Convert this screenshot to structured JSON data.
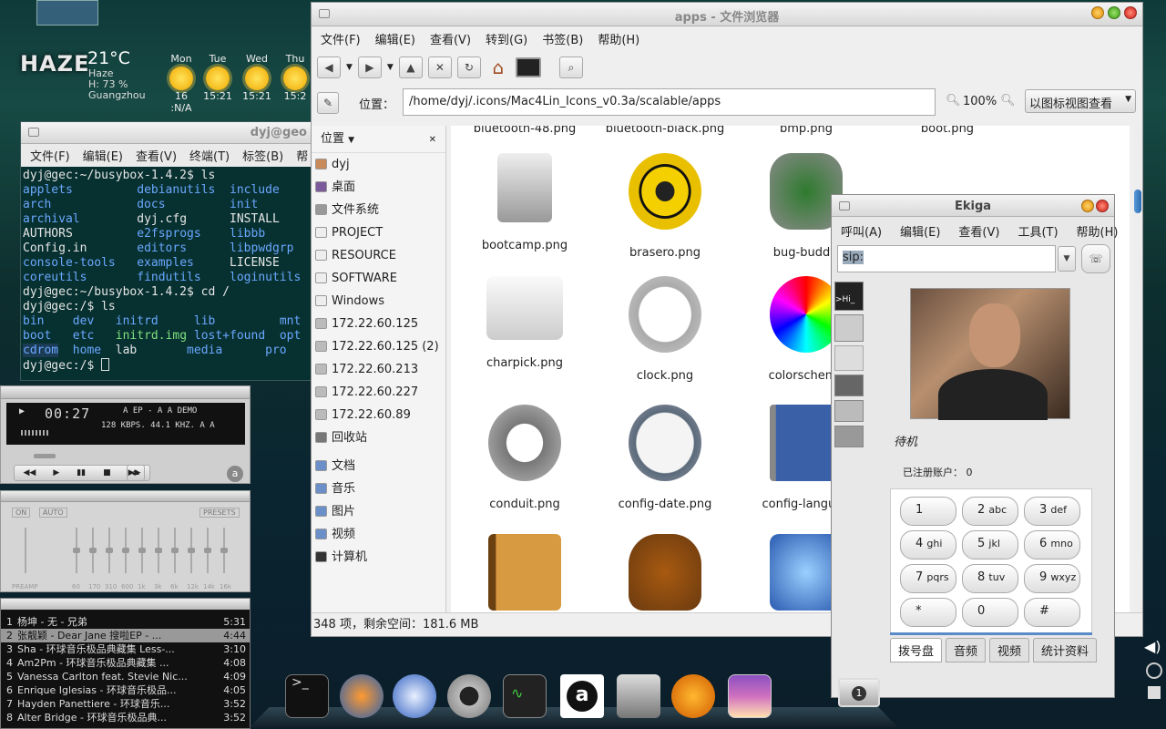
{
  "weather": {
    "brand": "HAZE",
    "temp": "21°C",
    "cond": "Haze",
    "humidity": "H: 73 %",
    "city": "Guangzhou",
    "days": [
      {
        "name": "Mon",
        "time": "16 :N/A"
      },
      {
        "name": "Tue",
        "time": "15:21"
      },
      {
        "name": "Wed",
        "time": "15:21"
      },
      {
        "name": "Thu",
        "time": "15:2"
      }
    ]
  },
  "terminal": {
    "title": "dyj@geo",
    "menu": [
      "文件(F)",
      "编辑(E)",
      "查看(V)",
      "终端(T)",
      "标签(B)",
      "帮"
    ],
    "l1": "dyj@gec:~/busybox-1.4.2$ ls",
    "rows": [
      [
        "applets",
        "debianutils",
        "include"
      ],
      [
        "arch",
        "docs",
        "init"
      ],
      [
        "archival",
        "dyj.cfg",
        "INSTALL"
      ],
      [
        "AUTHORS",
        "e2fsprogs",
        "libbb"
      ],
      [
        "Config.in",
        "editors",
        "libpwdgrp"
      ],
      [
        "console-tools",
        "examples",
        "LICENSE"
      ],
      [
        "coreutils",
        "findutils",
        "loginutils"
      ]
    ],
    "l2": "dyj@gec:~/busybox-1.4.2$ cd /",
    "l3": "dyj@gec:/$ ls",
    "rows2": [
      [
        "bin",
        "dev",
        "initrd",
        "lib",
        "mnt"
      ],
      [
        "boot",
        "etc",
        "initrd.img",
        "lost+found",
        "opt"
      ],
      [
        "cdrom",
        "home",
        "lab",
        "media",
        "pro"
      ]
    ],
    "prompt": "dyj@gec:/$ "
  },
  "player": {
    "time": "00:27",
    "info": "A EP - A   A   DEMO",
    "rate": "128 KBPS. 44.1 KHZ.   A   A"
  },
  "eq": {
    "on": "ON",
    "auto": "AUTO",
    "presets": "PRESETS",
    "preamp": "PREAMP",
    "bands": [
      "60",
      "170",
      "310",
      "600",
      "1k",
      "3k",
      "6k",
      "12k",
      "14k",
      "16k"
    ]
  },
  "playlist": [
    {
      "n": "1",
      "t": "杨坤 - 无 - 兄弟",
      "d": "5:31"
    },
    {
      "n": "2",
      "t": "张靓颖 - Dear Jane 搜啦EP - ...",
      "d": "4:44"
    },
    {
      "n": "3",
      "t": "Sha - 环球音乐极品典藏集 Less-...",
      "d": "3:10"
    },
    {
      "n": "4",
      "t": "Am2Pm - 环球音乐极品典藏集 ...",
      "d": "4:08"
    },
    {
      "n": "5",
      "t": "Vanessa Carlton feat. Stevie Nic...",
      "d": "4:09"
    },
    {
      "n": "6",
      "t": "Enrique Iglesias - 环球音乐极品...",
      "d": "4:05"
    },
    {
      "n": "7",
      "t": "Hayden Panettiere - 环球音乐...",
      "d": "3:52"
    },
    {
      "n": "8",
      "t": "Alter Bridge - 环球音乐极品典...",
      "d": "3:52"
    }
  ],
  "fb": {
    "title": "apps - 文件浏览器",
    "menu": [
      "文件(F)",
      "编辑(E)",
      "查看(V)",
      "转到(G)",
      "书签(B)",
      "帮助(H)"
    ],
    "loc_label": "位置：",
    "path": "/home/dyj/.icons/Mac4Lin_Icons_v0.3a/scalable/apps",
    "zoom": "100%",
    "view": "以图标视图查看",
    "side_header": "位置",
    "places": [
      "dyj",
      "桌面",
      "文件系统",
      "PROJECT",
      "RESOURCE",
      "SOFTWARE",
      "Windows",
      "172.22.60.125",
      "172.22.60.125 (2)",
      "172.22.60.213",
      "172.22.60.227",
      "172.22.60.89",
      "回收站",
      "文档",
      "音乐",
      "图片",
      "视频",
      "计算机"
    ],
    "files": [
      "bluetooth-48.png",
      "bluetooth-black.png",
      "bmp.png",
      "boot.png",
      "bootcamp.png",
      "brasero.png",
      "bug-buddy.",
      "charpick.png",
      "clock.png",
      "colorscheme",
      "conduit.png",
      "config-date.png",
      "config-languag"
    ],
    "status": "348 项，剩余空间：181.6 MB"
  },
  "ekiga": {
    "title": "Ekiga",
    "menu": [
      "呼叫(A)",
      "编辑(E)",
      "查看(V)",
      "工具(T)",
      "帮助(H)"
    ],
    "sip": "sip:",
    "status": "待机",
    "accounts": "已注册账户：  0",
    "keys": [
      [
        "1",
        ""
      ],
      [
        "2",
        "abc"
      ],
      [
        "3",
        "def"
      ],
      [
        "4",
        "ghi"
      ],
      [
        "5",
        "jkl"
      ],
      [
        "6",
        "mno"
      ],
      [
        "7",
        "pqrs"
      ],
      [
        "8",
        "tuv"
      ],
      [
        "9",
        "wxyz"
      ],
      [
        "*",
        ""
      ],
      [
        "0",
        ""
      ],
      [
        "#",
        ""
      ]
    ],
    "tabs": [
      "拨号盘",
      "音频",
      "视频",
      "统计资料"
    ]
  },
  "dock": {
    "badge": "1"
  }
}
